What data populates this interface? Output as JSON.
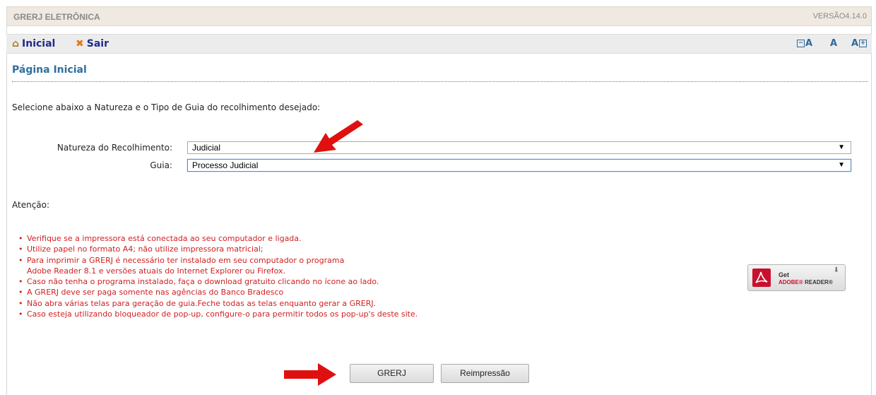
{
  "app": {
    "title": "GRERJ ELETRÔNICA",
    "version": "VERSÃO4.14.0"
  },
  "nav": {
    "home_label": "Inicial",
    "exit_label": "Sair",
    "font_decrease": "A",
    "font_normal": "A",
    "font_increase": "A"
  },
  "page": {
    "title": "Página Inicial",
    "instruction": "Selecione abaixo a Natureza e o Tipo de Guia do recolhimento desejado:"
  },
  "form": {
    "natureza_label": "Natureza do Recolhimento:",
    "natureza_value": "Judicial",
    "guia_label": "Guia:",
    "guia_value": "Processo Judicial"
  },
  "attention": {
    "heading": "Atenção:",
    "items": [
      "Verifique se a impressora está conectada ao seu computador e ligada.",
      "Utilize papel no formato A4; não utilize impressora matricial;",
      "Para imprimir a GRERJ é necessário ter instalado em seu computador o programa",
      "Adobe Reader 8.1 e versões atuais do Internet Explorer ou Firefox.",
      "Caso não tenha o programa instalado, faça o download gratuito clicando no ícone ao lado.",
      "A GRERJ deve ser paga somente nas agências do Banco Bradesco",
      "Não abra várias telas para geração de guia.Feche todas as telas enquanto gerar a GRERJ.",
      "Caso esteja utilizando bloqueador de pop-up, configure-o para permitir todos os pop-up's deste site."
    ]
  },
  "adobe_badge": {
    "get": "Get",
    "brand": "ADOBE",
    "product": "READER"
  },
  "buttons": {
    "grerj": "GRERJ",
    "reimpressao": "Reimpressão"
  },
  "colors": {
    "warning_text": "#d12020",
    "title_blue": "#2e6f9e",
    "nav_blue": "#1f2a8a",
    "annotation_arrow": "#e01010"
  }
}
